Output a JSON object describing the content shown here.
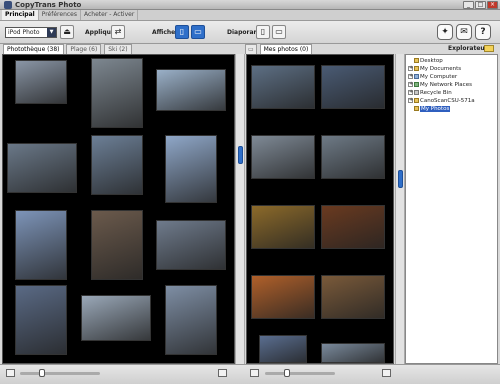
{
  "window": {
    "title": "CopyTrans Photo"
  },
  "top_tabs": [
    {
      "label": "Principal"
    },
    {
      "label": "Préférences"
    },
    {
      "label": "Acheter - Activer"
    }
  ],
  "toolbar": {
    "device_select_value": "iPod Photo",
    "apply_label": "Appliquer",
    "show_label": "Afficher",
    "slideshow_label": "Diaporama"
  },
  "left_panel": {
    "tabs": [
      {
        "label": "Photothèque (38)"
      },
      {
        "label": "Plage (6)"
      },
      {
        "label": "Ski (2)"
      }
    ],
    "thumb_colors": [
      "#8a96a6",
      "#7d8790",
      "#9ab0c8",
      "#6a7888",
      "#6c7f96",
      "#8fa7c8",
      "#7d94b8",
      "#6b5a4c",
      "#6f7b8c",
      "#5a6a85",
      "#9aa8b8",
      "#7e8ea4"
    ]
  },
  "right_panel": {
    "tab": {
      "label": "Mes photos (0)"
    },
    "thumb_colors": [
      "#5d6f84",
      "#4a5b74",
      "#7f8a96",
      "#6e7a86",
      "#8c6a2a",
      "#6a3a20",
      "#b0602a",
      "#7a5a3a",
      "#5a6e90",
      "#7a8a9c"
    ]
  },
  "explorer": {
    "title": "Explorateur",
    "tree": [
      {
        "label": "Desktop",
        "expandable": false
      },
      {
        "label": "My Documents",
        "expandable": true
      },
      {
        "label": "My Computer",
        "expandable": true
      },
      {
        "label": "My Network Places",
        "expandable": true
      },
      {
        "label": "Recycle Bin",
        "expandable": true
      },
      {
        "label": "CanoScanCSU-571a",
        "expandable": true
      },
      {
        "label": "My Photos",
        "expandable": false,
        "selected": true
      }
    ]
  },
  "statusbar": {
    "left_zoom": 0.25,
    "right_zoom": 0.3
  }
}
